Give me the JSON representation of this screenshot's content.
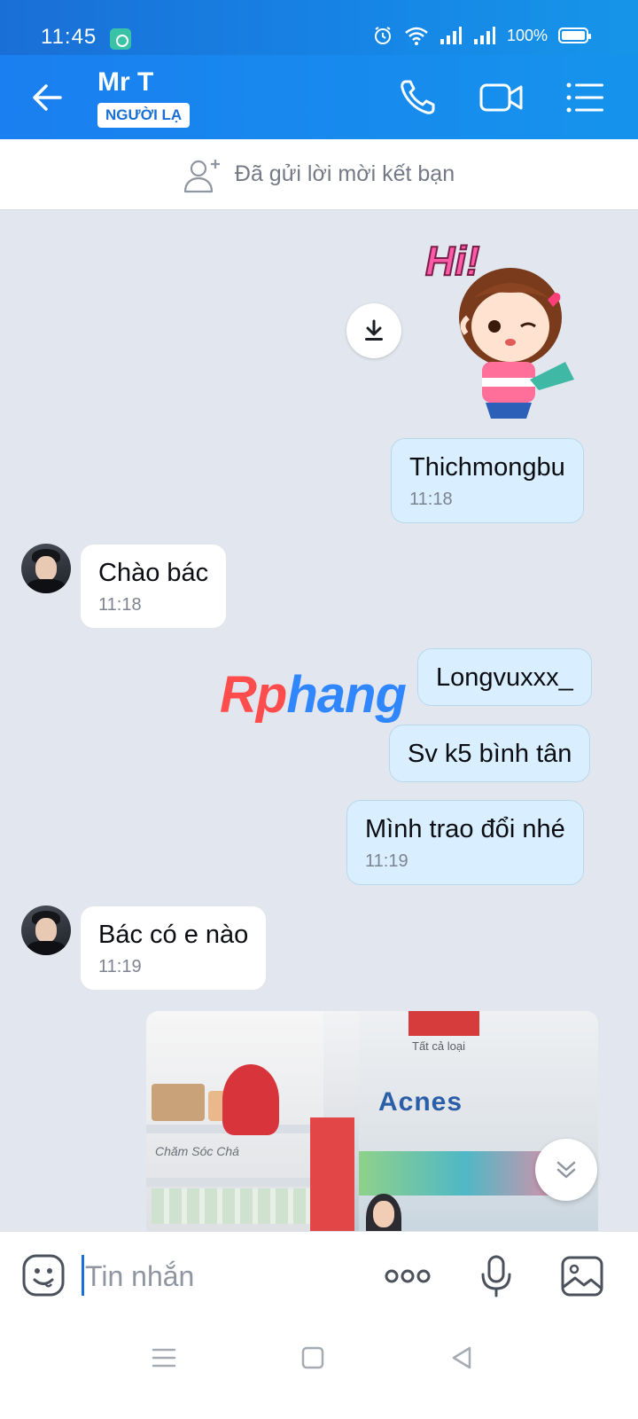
{
  "status_bar": {
    "time": "11:45",
    "battery": "100%"
  },
  "header": {
    "contact_name": "Mr T",
    "badge": "NGƯỜI LẠ"
  },
  "friend_banner": {
    "text": "Đã gửi lời mời kết bạn"
  },
  "messages": [
    {
      "side": "me",
      "type": "sticker"
    },
    {
      "side": "me",
      "text": "Thichmongbu",
      "time": "11:18"
    },
    {
      "side": "them",
      "text": "Chào bác",
      "time": "11:18"
    },
    {
      "side": "me",
      "text": "Longvuxxx_"
    },
    {
      "side": "me",
      "text": "Sv k5 bình tân"
    },
    {
      "side": "me",
      "text": "Mình trao đổi nhé",
      "time": "11:19"
    },
    {
      "side": "them",
      "text": "Bác có e nào",
      "time": "11:19"
    },
    {
      "side": "me",
      "type": "photo"
    }
  ],
  "sticker": {
    "text": "Hi!"
  },
  "photo": {
    "sign_1": "Tất cả loại",
    "sign_2": "Acnes",
    "sign_3": "Chăm Sóc Chá"
  },
  "watermark": {
    "part1": "Rp",
    "part2": "hang"
  },
  "composer": {
    "placeholder": "Tin nhắn"
  },
  "colors": {
    "primary": "#1a7ff0",
    "my_bubble": "#d9efff",
    "their_bubble": "#ffffff",
    "chat_bg": "#e2e7ef"
  },
  "icons": [
    "back-arrow-icon",
    "phone-icon",
    "video-call-icon",
    "menu-icon",
    "add-friend-icon",
    "download-icon",
    "scroll-down-icon",
    "emoji-icon",
    "more-icon",
    "microphone-icon",
    "image-icon"
  ]
}
